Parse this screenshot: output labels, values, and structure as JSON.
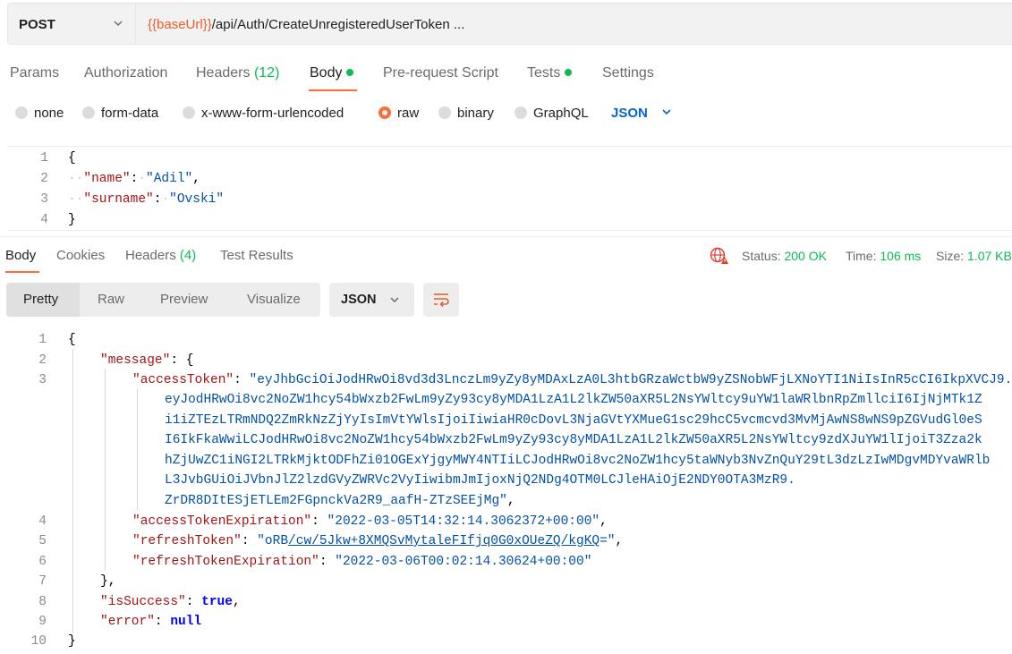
{
  "request": {
    "method": "POST",
    "url_var": "{{baseUrl}}",
    "url_path": "/api/Auth/CreateUnregisteredUserToken ...",
    "tabs": {
      "params": "Params",
      "authorization": "Authorization",
      "headers": "Headers",
      "headers_count": "(12)",
      "body": "Body",
      "prerequest": "Pre-request Script",
      "tests": "Tests",
      "settings": "Settings"
    },
    "body_types": {
      "none": "none",
      "form_data": "form-data",
      "urlencoded": "x-www-form-urlencoded",
      "raw": "raw",
      "binary": "binary",
      "graphql": "GraphQL"
    },
    "format": "JSON",
    "body_lines": {
      "l1_n": "1",
      "l2_n": "2",
      "l3_n": "3",
      "l4_n": "4",
      "open": "{",
      "close": "}",
      "k1": "\"name\"",
      "v1": "\"Adil\"",
      "k2": "\"surname\"",
      "v2": "\"Ovski\""
    }
  },
  "response": {
    "tabs": {
      "body": "Body",
      "cookies": "Cookies",
      "headers": "Headers",
      "headers_count": "(4)",
      "test_results": "Test Results"
    },
    "status_label": "Status:",
    "status_value": "200 OK",
    "time_label": "Time:",
    "time_value": "106 ms",
    "size_label": "Size:",
    "size_value": "1.07 KB",
    "views": {
      "pretty": "Pretty",
      "raw": "Raw",
      "preview": "Preview",
      "visualize": "Visualize"
    },
    "format": "JSON",
    "line_numbers": [
      "1",
      "2",
      "3",
      "",
      "",
      "",
      "",
      "",
      "",
      "4",
      "5",
      "6",
      "7",
      "8",
      "9",
      "10"
    ],
    "code": {
      "open": "{",
      "message_key": "\"message\"",
      "access_key": "\"accessToken\"",
      "token_lines": [
        "\"eyJhbGciOiJodHRwOi8vd3d3LnczLm9yZy8yMDAxLzA0L3htbGRzaWctbW9yZSNobWFjLXNoYTI1NiIsInR5cCI6IkpXVCJ9.",
        "eyJodHRwOi8vc2NoZW1hcy54bWxzb2FwLm9yZy93cy8yMDA1LzA1L2lkZW50aXR5L2NsYWltcy9uYW1laWRlbnRpZmllciI6IjNjMTk1Z",
        "i1iZTEzLTRmNDQ2ZmRkNzZjYyIsImVtYWlsIjoiIiwiaHR0cDovL3NjaGVtYXMueG1sc29hcC5vcmcvd3MvMjAwNS8wNS9pZGVudGl0eS",
        "I6IkFkaWwiLCJodHRwOi8vc2NoZW1hcy54bWxzb2FwLm9yZy93cy8yMDA1LzA1L2lkZW50aXR5L2NsYWltcy9zdXJuYW1lIjoiT3Zza2k",
        "hZjUwZC1iNGI2LTRkMjktODFhZi01OGExYjgyMWY4NTIiLCJodHRwOi8vc2NoZW1hcy5taWNyb3NvZnQuY29tL3dzLzIwMDgvMDYvaWRlb",
        "L3JvbGUiOiJVbnJlZ2lzdGVyZWRVc2VyIiwibmJmIjoxNjQ2NDg4OTM0LCJleHAiOjE2NDY0OTA3MzR9.",
        "ZrDR8DItESjETLEm2FGpnckVa2R9_aafH-ZTzSEEjMg\""
      ],
      "access_exp_key": "\"accessTokenExpiration\"",
      "access_exp_val": "\"2022-03-05T14:32:14.3062372+00:00\"",
      "refresh_key": "\"refreshToken\"",
      "refresh_val_a": "\"oRB",
      "refresh_val_b": "/cw/5Jkw+8XMQSvMytaleFIfjq0G0xOUeZQ/kgKQ",
      "refresh_val_c": "=\"",
      "refresh_exp_key": "\"refreshTokenExpiration\"",
      "refresh_exp_val": "\"2022-03-06T00:02:14.30624+00:00\"",
      "close_inner": "}",
      "success_key": "\"isSuccess\"",
      "success_val": "true",
      "error_key": "\"error\"",
      "error_val": "null",
      "close": "}"
    }
  },
  "colors": {
    "accent": "#ff6c37",
    "success": "#0cbb52",
    "variable": "#eb5e28",
    "json_format": "#0265d2",
    "json_key": "#a31515",
    "json_string": "#0451a5",
    "json_keyword": "#0000ff",
    "alert_icon": "#e03c31"
  },
  "icons": [
    "chevron-down-icon",
    "globe-alert-icon",
    "wrap-lines-icon"
  ]
}
